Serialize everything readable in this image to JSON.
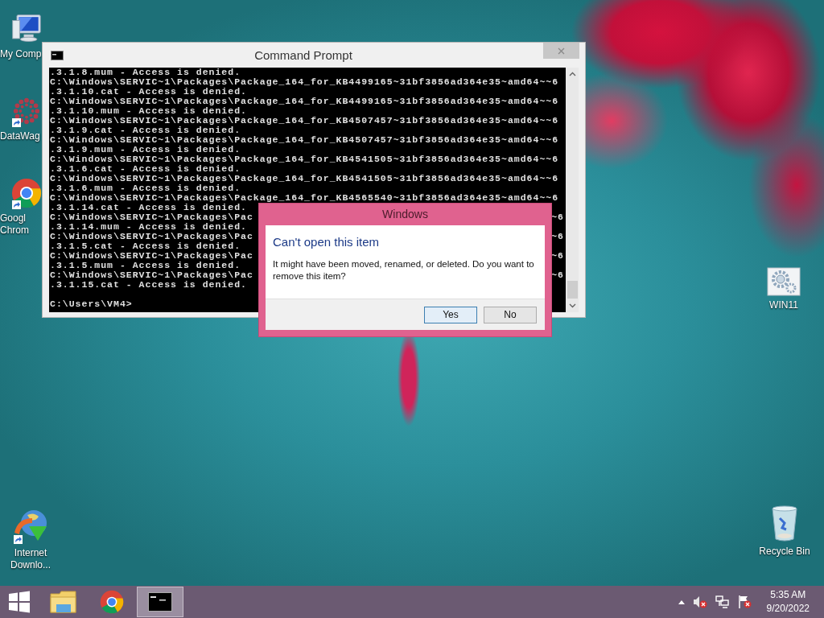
{
  "desktop_icons": [
    {
      "kind": "computer",
      "lines": [
        "My Comp"
      ],
      "shortcut": false
    },
    {
      "kind": "datawag",
      "lines": [
        "DataWag"
      ],
      "shortcut": true
    },
    {
      "kind": "chrome",
      "lines": [
        "Googl",
        "Chrom"
      ],
      "shortcut": true
    },
    {
      "kind": "downloader",
      "lines": [
        "Internet",
        "Downlo..."
      ],
      "shortcut": true
    },
    {
      "kind": "settings",
      "lines": [
        "WIN11"
      ],
      "shortcut": false
    },
    {
      "kind": "recycle",
      "lines": [
        "Recycle Bin"
      ],
      "shortcut": false
    }
  ],
  "console_window": {
    "title": "Command Prompt",
    "lines": [
      {
        "text": ".3.1.8.mum - Access is denied."
      },
      {
        "text": "C:\\Windows\\SERVIC~1\\Packages\\Package_164_for_KB4499165~31bf3856ad364e35~amd64~~6"
      },
      {
        "text": ".3.1.10.cat - Access is denied."
      },
      {
        "text": "C:\\Windows\\SERVIC~1\\Packages\\Package_164_for_KB4499165~31bf3856ad364e35~amd64~~6"
      },
      {
        "text": ".3.1.10.mum - Access is denied."
      },
      {
        "text": "C:\\Windows\\SERVIC~1\\Packages\\Package_164_for_KB4507457~31bf3856ad364e35~amd64~~6"
      },
      {
        "text": ".3.1.9.cat - Access is denied."
      },
      {
        "text": "C:\\Windows\\SERVIC~1\\Packages\\Package_164_for_KB4507457~31bf3856ad364e35~amd64~~6"
      },
      {
        "text": ".3.1.9.mum - Access is denied."
      },
      {
        "text": "C:\\Windows\\SERVIC~1\\Packages\\Package_164_for_KB4541505~31bf3856ad364e35~amd64~~6"
      },
      {
        "text": ".3.1.6.cat - Access is denied."
      },
      {
        "text": "C:\\Windows\\SERVIC~1\\Packages\\Package_164_for_KB4541505~31bf3856ad364e35~amd64~~6"
      },
      {
        "text": ".3.1.6.mum - Access is denied."
      },
      {
        "text": "C:\\Windows\\SERVIC~1\\Packages\\Package_164_for_KB4565540~31bf3856ad364e35~amd64~~6"
      },
      {
        "text": ".3.1.14.cat - Access is denied."
      },
      {
        "text": "C:\\Windows\\SERVIC~1\\Packages\\Pac",
        "tail": "~6"
      },
      {
        "text": ".3.1.14.mum - Access is denied."
      },
      {
        "text": "C:\\Windows\\SERVIC~1\\Packages\\Pac",
        "tail": "~6"
      },
      {
        "text": ".3.1.5.cat - Access is denied."
      },
      {
        "text": "C:\\Windows\\SERVIC~1\\Packages\\Pac",
        "tail": "~6"
      },
      {
        "text": ".3.1.5.mum - Access is denied."
      },
      {
        "text": "C:\\Windows\\SERVIC~1\\Packages\\Pac",
        "tail": "~6"
      },
      {
        "text": ".3.1.15.cat - Access is denied."
      }
    ],
    "prompt": "C:\\Users\\VM4>"
  },
  "dialog": {
    "title": "Windows",
    "heading": "Can't open this item",
    "message": "It might have been moved, renamed, or deleted. Do you want to remove this item?",
    "buttons": [
      {
        "label": "Yes",
        "focused": true
      },
      {
        "label": "No",
        "focused": false
      }
    ]
  },
  "taskbar": {
    "apps": [
      {
        "kind": "explorer",
        "active": false
      },
      {
        "kind": "chrome",
        "active": false
      },
      {
        "kind": "console",
        "active": true
      }
    ],
    "time": "5:35 AM",
    "date": "9/20/2022"
  }
}
